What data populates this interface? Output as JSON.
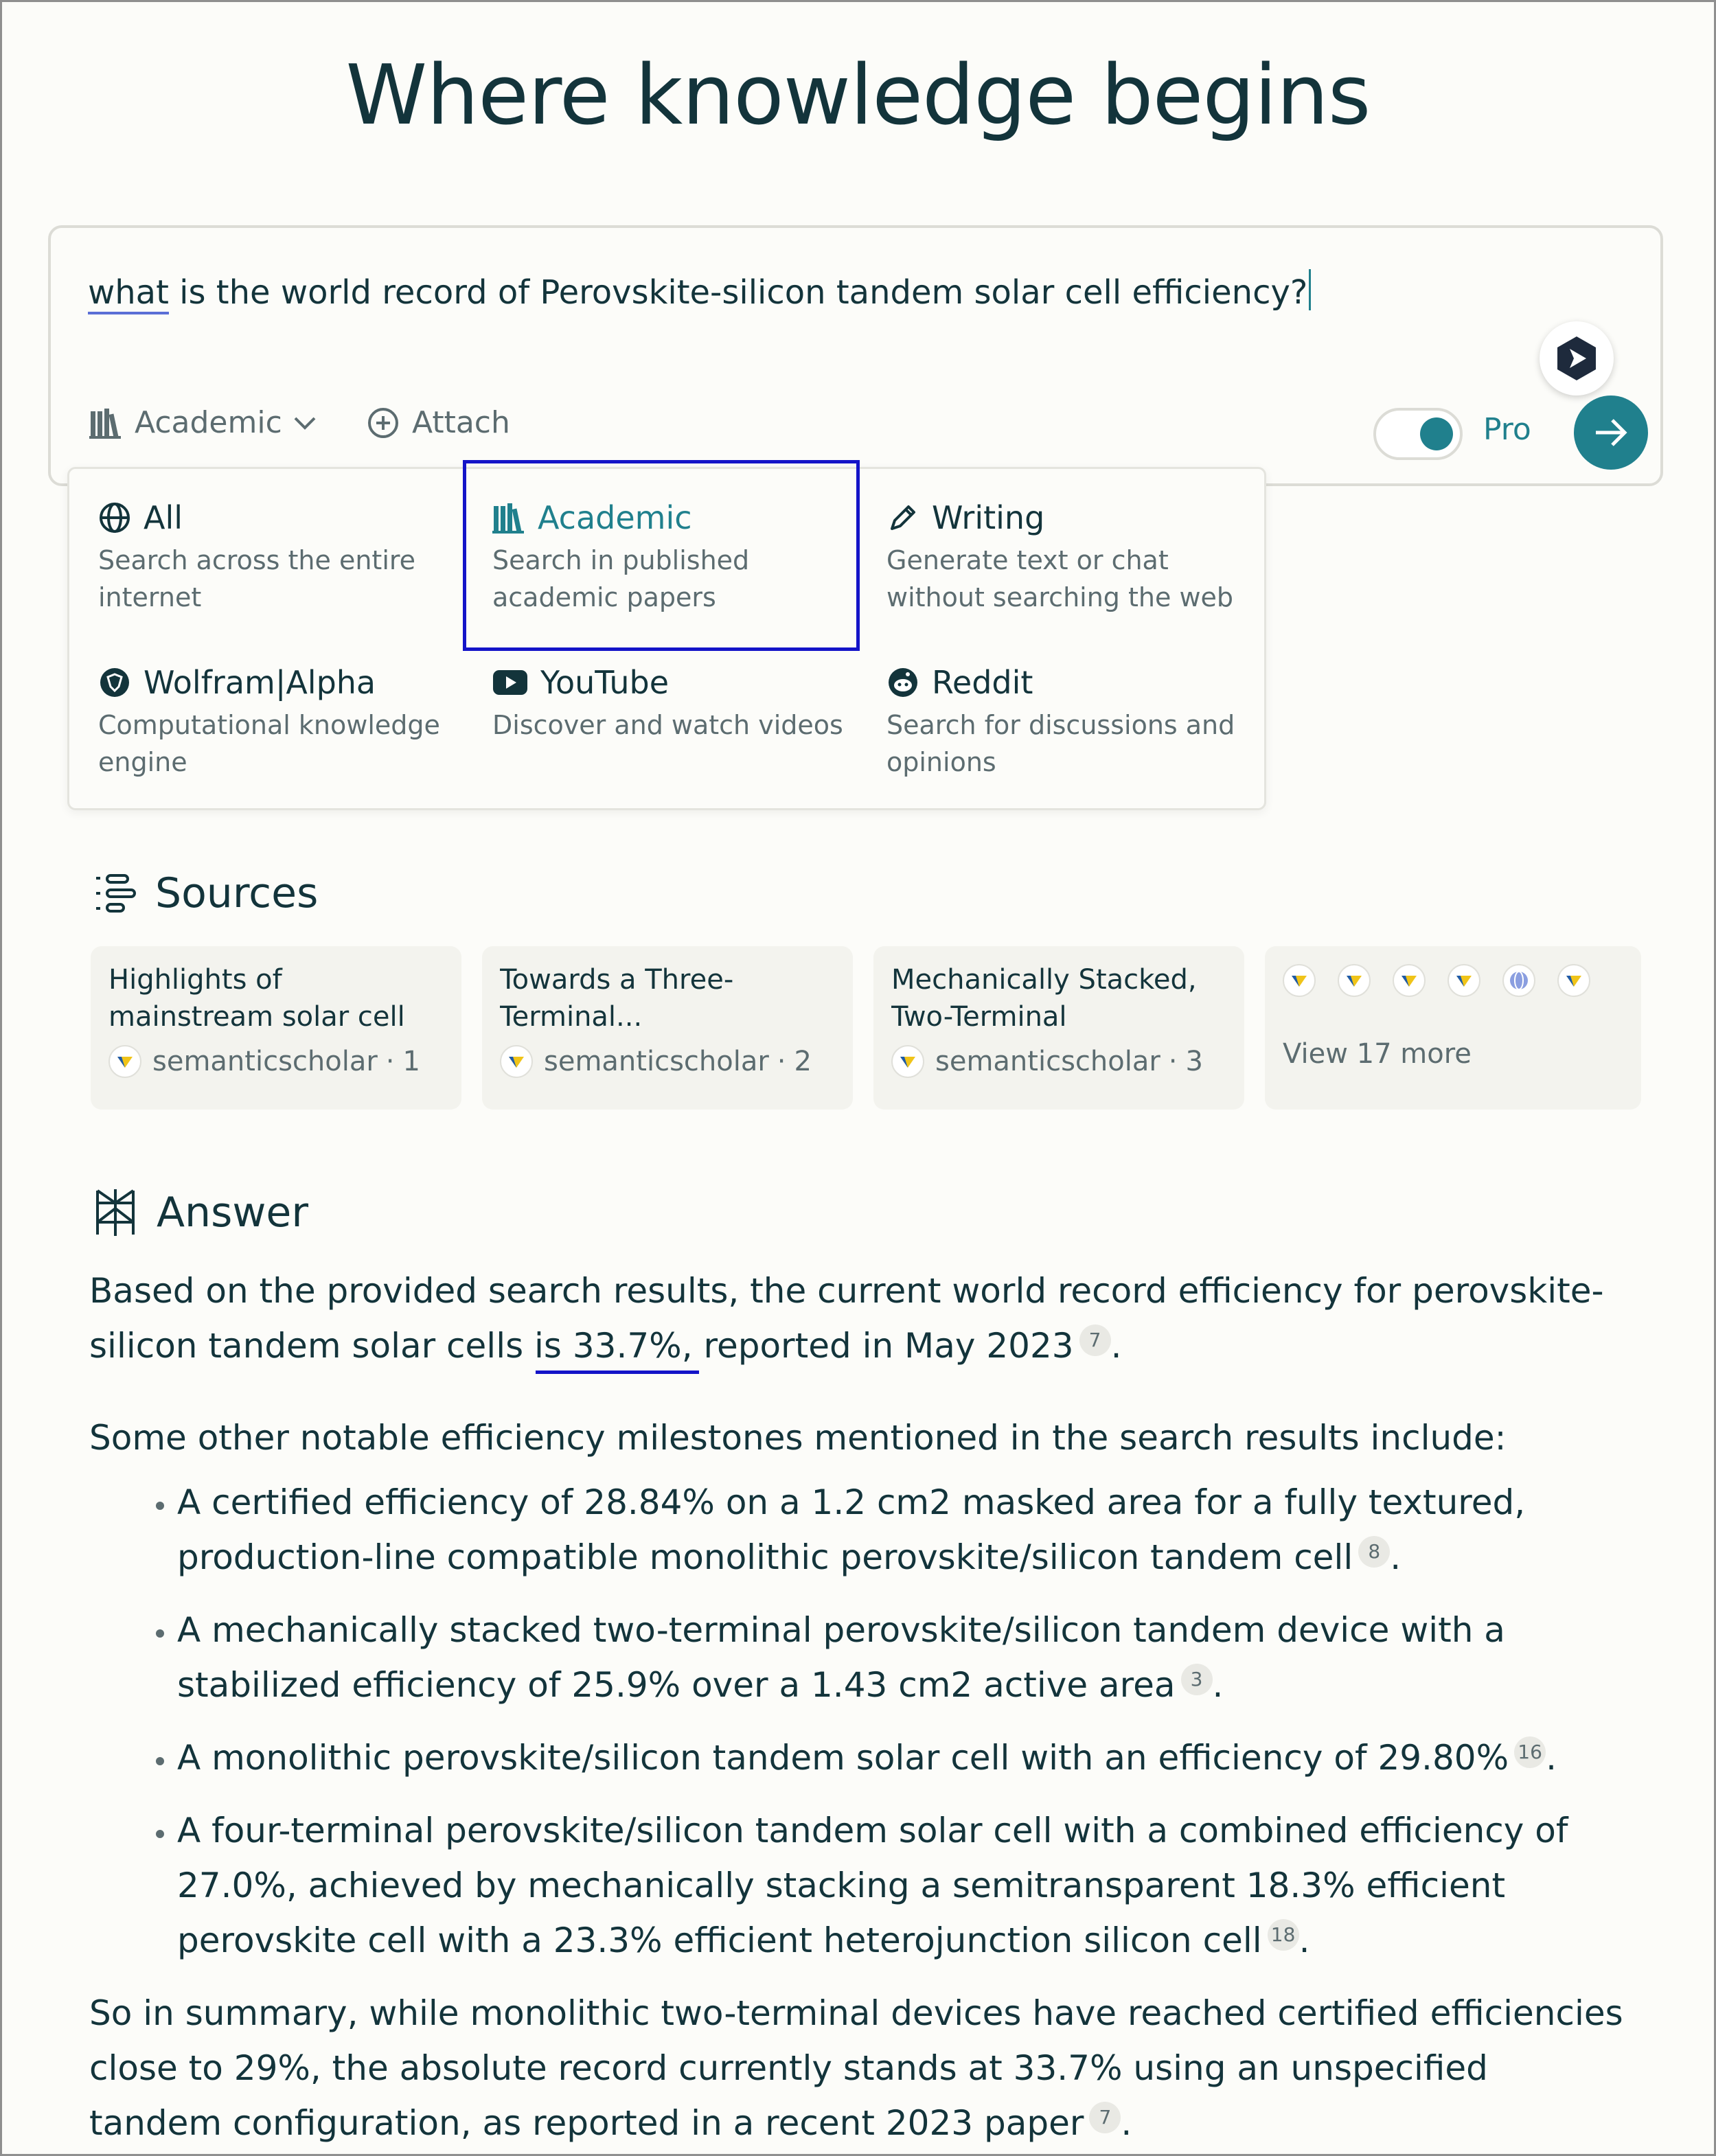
{
  "heading": "Where knowledge begins",
  "search": {
    "query_first_word": "what",
    "query_rest": " is the world record of Perovskite-silicon tandem solar cell efficiency?",
    "focus_label": "Academic",
    "attach_label": "Attach",
    "pro_label": "Pro",
    "pro_enabled": true
  },
  "focus_options": [
    {
      "label": "All",
      "desc": "Search across the entire internet",
      "icon": "globe-icon",
      "selected": false
    },
    {
      "label": "Academic",
      "desc": "Search in published academic papers",
      "icon": "books-icon",
      "selected": true
    },
    {
      "label": "Writing",
      "desc": "Generate text or chat without searching the web",
      "icon": "pencil-icon",
      "selected": false
    },
    {
      "label": "Wolfram|Alpha",
      "desc": "Computational knowledge engine",
      "icon": "wolfram-icon",
      "selected": false
    },
    {
      "label": "YouTube",
      "desc": "Discover and watch videos",
      "icon": "youtube-icon",
      "selected": false
    },
    {
      "label": "Reddit",
      "desc": "Search for discussions and opinions",
      "icon": "reddit-icon",
      "selected": false
    }
  ],
  "sources": {
    "heading": "Sources",
    "cards": [
      {
        "title": "Highlights of mainstream solar cell efficiencies in...",
        "site": "semanticscholar",
        "index": "1"
      },
      {
        "title": "Towards a Three-Terminal...",
        "site": "semanticscholar",
        "index": "2"
      },
      {
        "title": "Mechanically Stacked, Two-Terminal Graphene...",
        "site": "semanticscholar",
        "index": "3"
      }
    ],
    "more_label": "View 17 more"
  },
  "answer": {
    "heading": "Answer",
    "p1_a": "Based on the provided search results, the current world record efficiency for perovskite-silicon tandem solar cells is 33.7%, reported in May 2023",
    "p1_cite": "7",
    "p2": "Some other notable efficiency milestones mentioned in the search results include:",
    "bullets": [
      {
        "text": "A certified efficiency of 28.84% on a 1.2 cm2 masked area for a fully textured, production-line compatible monolithic perovskite/silicon tandem cell",
        "cite": "8"
      },
      {
        "text": "A mechanically stacked two-terminal perovskite/silicon tandem device with a stabilized efficiency of 25.9% over a 1.43 cm2 active area",
        "cite": "3"
      },
      {
        "text": "A monolithic perovskite/silicon tandem solar cell with an efficiency of 29.80%",
        "cite": "16"
      },
      {
        "text": "A four-terminal perovskite/silicon tandem solar cell with a combined efficiency of 27.0%, achieved by mechanically stacking a semitransparent 18.3% efficient perovskite cell with a 23.3% efficient heterojunction silicon cell",
        "cite": "18"
      }
    ],
    "p3": "So in summary, while monolithic two-terminal devices have reached certified efficiencies close to 29%, the absolute record currently stands at 33.7% using an unspecified tandem configuration, as reported in a recent 2023 paper",
    "p3_cite": "7"
  },
  "colors": {
    "accent": "#20808d",
    "text": "#13343b",
    "muted": "#5c6c70",
    "highlight_box": "#1414c8"
  }
}
